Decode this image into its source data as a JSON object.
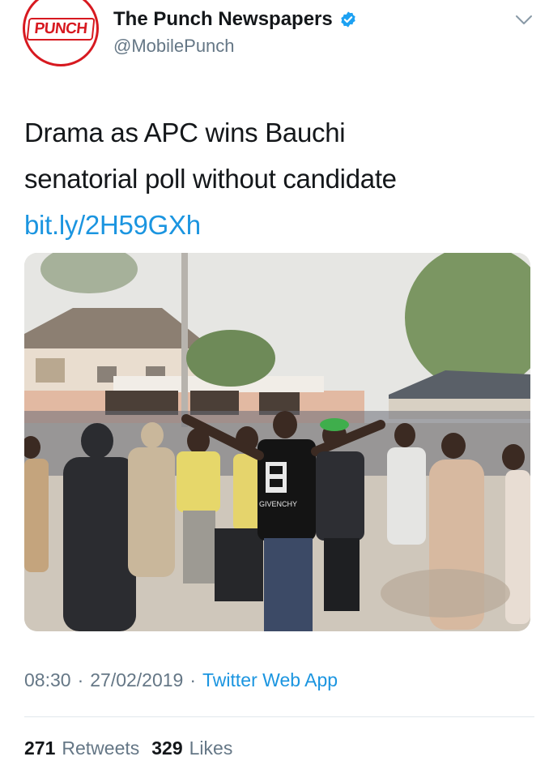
{
  "account": {
    "display_name": "The Punch Newspapers",
    "handle": "@MobilePunch",
    "avatar_text": "PUNCH",
    "verified": true,
    "brand_color": "#d71920",
    "verified_color": "#1da1f2"
  },
  "tweet": {
    "text_line1": "Drama as APC wins Bauchi",
    "text_line2": "senatorial poll without candidate",
    "link": "bit.ly/2H59GXh",
    "shirt_text": "GIVENCHY"
  },
  "meta": {
    "time": "08:30",
    "separator1": "·",
    "date": "27/02/2019",
    "separator2": "·",
    "source": "Twitter Web App"
  },
  "stats": {
    "retweets_count": "271",
    "retweets_label": "Retweets",
    "likes_count": "329",
    "likes_label": "Likes"
  },
  "colors": {
    "link": "#1b95e0",
    "secondary_text": "#657786",
    "primary_text": "#14171a"
  },
  "icons": [
    "verified-badge-icon",
    "chevron-down-icon"
  ]
}
